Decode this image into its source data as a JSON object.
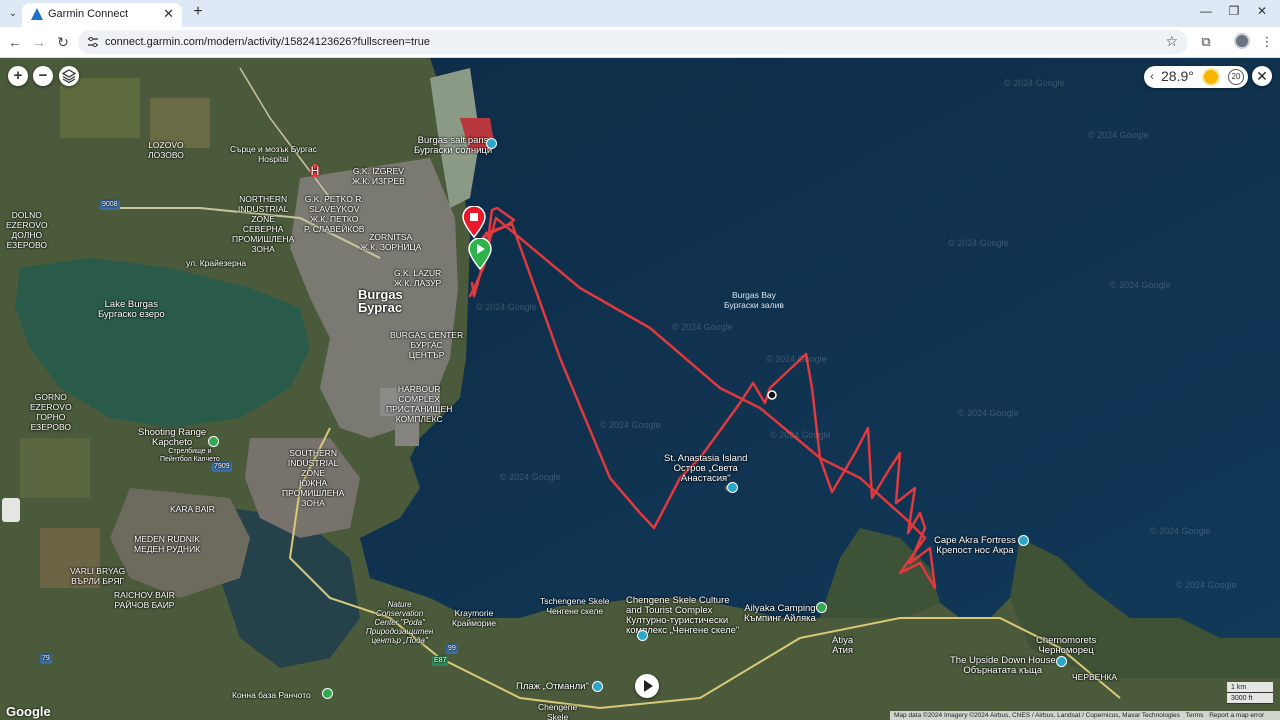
{
  "browser": {
    "tab_title": "Garmin Connect",
    "url": "connect.garmin.com/modern/activity/15824123626?fullscreen=true",
    "new_tab_symbol": "+",
    "close_tab_symbol": "✕"
  },
  "weather": {
    "temperature": "28.9°",
    "wind_speed": "20"
  },
  "map": {
    "attribution": "Map data ©2024 Imagery ©2024 Airbus, CNES / Airbus, Landsat / Copernicus, Maxar Technologies",
    "terms": "Terms",
    "report": "Report a map error",
    "scale_metric": "1 km",
    "scale_imperial": "3000 ft",
    "google": "Google",
    "watermark": "© 2024 Google",
    "labels": {
      "lozovo": "LOZOVO\nЛОЗОВО",
      "heart_hospital": "Сърце и мозък Бургас\nHospital",
      "izgrev": "G.K. IZGREV\nЖ.К. ИЗГРЕВ",
      "salt_pans": "Burgas salt pans\nБургаски солници",
      "dolno_ezerovo": "DOLNO\nEZEROVO\nДОЛНО\nЕЗЕРОВО",
      "north_industrial": "NORTHERN\nINDUSTRIAL\nZONE\nСЕВЕРНА\nПРОМИШЛЕНА\nЗОНА",
      "petko": "G.K. PETKO R.\nSLAVEYKOV\nЖ.К. ПЕТКО\nР. СЛАВЕЙКОВ",
      "zornitsa": "ZORNITSA\nЖ.К. ЗОРНИЦА",
      "kraymorie_ul": "ул. Крайезерна",
      "lazur": "G.K. LAZUR\nЖ.К. ЛАЗУР",
      "lake_burgas": "Lake Burgas\nБургаско езеро",
      "burgas": "Burgas\nБургас",
      "burgas_center": "BURGAS CENTER\nБУРГАС\nЦЕНТЪР",
      "gorno_ezerovo": "GORNO\nEZEROVO\nГОРНО\nЕЗЕРОВО",
      "harbour": "HARBOUR\nCOMPLEX\nПРИСТАНИЩЕН\nКОМПЛЕКС",
      "shooting_range": "Shooting Range\nKapcheto",
      "strelishte": "Стрелбище и\nПейнтбол Капчето",
      "south_industrial": "SOUTHERN\nINDUSTRIAL\nZONE\nЮЖНА\nПРОМИШЛЕНА\nЗОНА",
      "kara_bair": "KARA BAIR",
      "meden_rudnik": "MEDEN RUDNIK\nМЕДЕН РУДНИК",
      "varli_bryag": "VARLI BRYAG\nВЪРЛИ БРЯГ",
      "raichov_bair": "RAICHOV BAIR\nРАЙЧОВ БАИР",
      "nature_center": "Nature\nConservation\nCenter \"Poda\"\nПриродозащитен\nцентър „Пода\"",
      "kraymorie": "Kraymorie\nКрайморие",
      "konna_baza": "Конна база Ранчото",
      "otmanli": "Плаж „Отманли\"",
      "chengene_skele": "Chengene\nSkele",
      "tschengene_skele": "Tschengene Skele\nЧенгене скеле",
      "chengene_complex": "Chengene Skele Culture\nand Tourist Complex\nКултурно-туристически\nкомплекс „Ченгене скеле\"",
      "ailyaka": "Ailyaka Camping\nКъмпинг Айляка",
      "atiya": "Atiya\nАтия",
      "upside_down": "The Upside Down House\nОбърнатата къща",
      "chernomorets": "Chernomorets\nЧерноморец",
      "chervenka": "ЧЕРВЕНКА",
      "cape_akra": "Cape Akra Fortress\nКрепост нос Акра",
      "st_anastasia": "St. Anastasia Island\nОстров „Света\nАнастасия\"",
      "burgas_bay": "Burgas Bay\nБургаски залив",
      "road_9008": "9008",
      "road_7909": "7909",
      "road_79": "79",
      "road_99": "99",
      "road_e87": "E87",
      "hospital_h": "H"
    }
  },
  "track_color": "#e0393e",
  "start_color": "#2db34a",
  "end_color": "#e8192c",
  "icons": {
    "tab_menu": "chevron-down-icon",
    "back": "arrow-left-icon",
    "forward": "arrow-right-icon",
    "reload": "reload-icon",
    "bookmark": "star-icon",
    "extensions": "puzzle-icon",
    "zoom_in": "plus-icon",
    "zoom_out": "minus-icon",
    "layers": "layers-icon",
    "close": "close-icon",
    "play": "play-icon"
  }
}
